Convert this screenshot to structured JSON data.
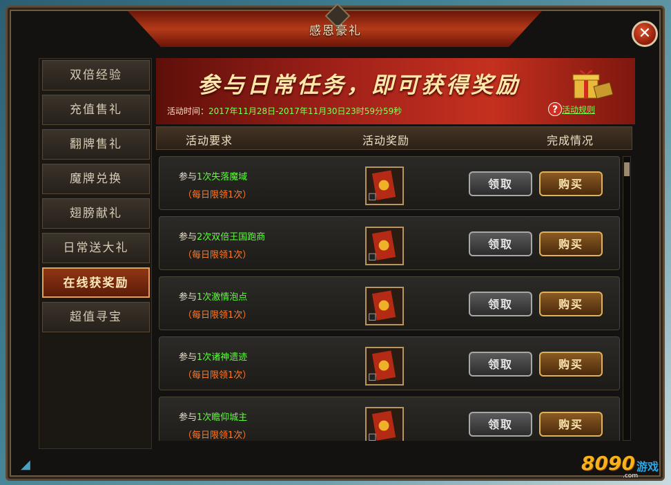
{
  "window": {
    "title": "感恩豪礼",
    "close_label": "✕"
  },
  "sidebar": {
    "items": [
      {
        "label": "双倍经验"
      },
      {
        "label": "充值售礼"
      },
      {
        "label": "翻牌售礼"
      },
      {
        "label": "魔牌兑换"
      },
      {
        "label": "翅膀献礼"
      },
      {
        "label": "日常送大礼"
      },
      {
        "label": "在线获奖励"
      },
      {
        "label": "超值寻宝"
      }
    ],
    "active_index": 6
  },
  "banner": {
    "title": "参与日常任务，即可获得奖励",
    "time_label": "活动时间：",
    "time_value": "2017年11月28日-2017年11月30日23时59分59秒",
    "rules_label": "活动规则",
    "help_icon": "?"
  },
  "table": {
    "headers": {
      "requirement": "活动要求",
      "reward": "活动奖励",
      "status": "完成情况"
    },
    "rows": [
      {
        "prefix": "参与",
        "task": "1次失落魔域",
        "limit": "（每日限领1次）",
        "claim": "领取",
        "buy": "购买"
      },
      {
        "prefix": "参与",
        "task": "2次双倍王国跑商",
        "limit": "（每日限领1次）",
        "claim": "领取",
        "buy": "购买"
      },
      {
        "prefix": "参与",
        "task": "1次激情泡点",
        "limit": "（每日限领1次）",
        "claim": "领取",
        "buy": "购买"
      },
      {
        "prefix": "参与",
        "task": "1次诸神遗迹",
        "limit": "（每日限领1次）",
        "claim": "领取",
        "buy": "购买"
      },
      {
        "prefix": "参与",
        "task": "1次瞻仰城主",
        "limit": "（每日限领1次）",
        "claim": "领取",
        "buy": "购买"
      }
    ]
  },
  "watermark": {
    "number": "8090",
    "text": "游戏",
    "domain": ".com"
  },
  "colors": {
    "accent": "#e0a254",
    "highlight": "#5cff3a",
    "limit": "#ff7a2a"
  }
}
